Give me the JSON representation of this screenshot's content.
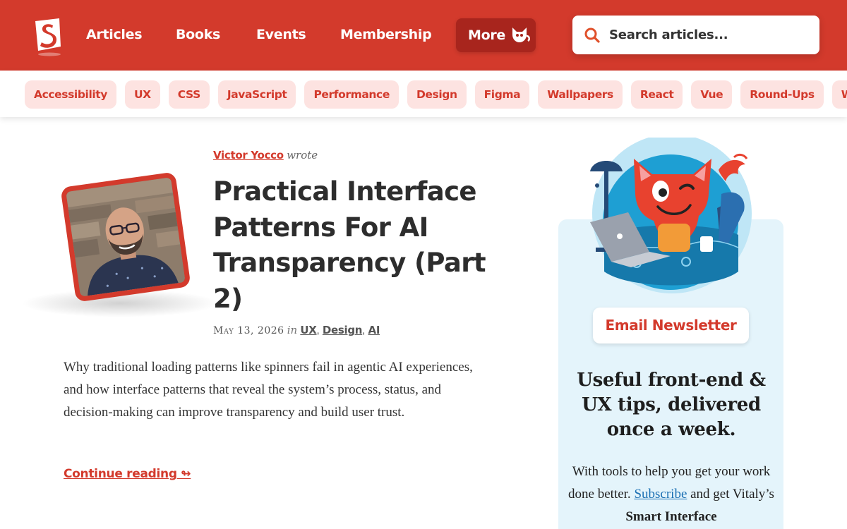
{
  "header": {
    "nav": [
      "Articles",
      "Books",
      "Events",
      "Membership"
    ],
    "more_label": "More",
    "search_placeholder": "Search articles..."
  },
  "tags": [
    "Accessibility",
    "UX",
    "CSS",
    "JavaScript",
    "Performance",
    "Design",
    "Figma",
    "Wallpapers",
    "React",
    "Vue",
    "Round-Ups",
    "Web Design"
  ],
  "article": {
    "author": "Victor Yocco",
    "wrote": "wrote",
    "title": "Practical Interface Patterns For AI Transparency (Part 2)",
    "date": "May 13, 2026",
    "in_word": "in",
    "categories": [
      "UX",
      "Design",
      "AI"
    ],
    "excerpt": "Why traditional loading patterns like spinners fail in agentic AI experiences, and how interface patterns that reveal the system’s process, status, and decision-making can improve transparency and build user trust.",
    "continue_label": "Continue reading ↬"
  },
  "newsletter": {
    "badge": "Email Newsletter",
    "heading": "Useful front-end & UX tips, delivered once a week.",
    "text_before": "With tools to help you get your work done better.",
    "subscribe_link": "Subscribe",
    "text_after": "and get Vitaly’s",
    "bold_text": "Smart Interface"
  },
  "colors": {
    "brand_red": "#d33a2c",
    "tag_bg": "#fde3e1",
    "panel_bg": "#e4f4fb"
  }
}
